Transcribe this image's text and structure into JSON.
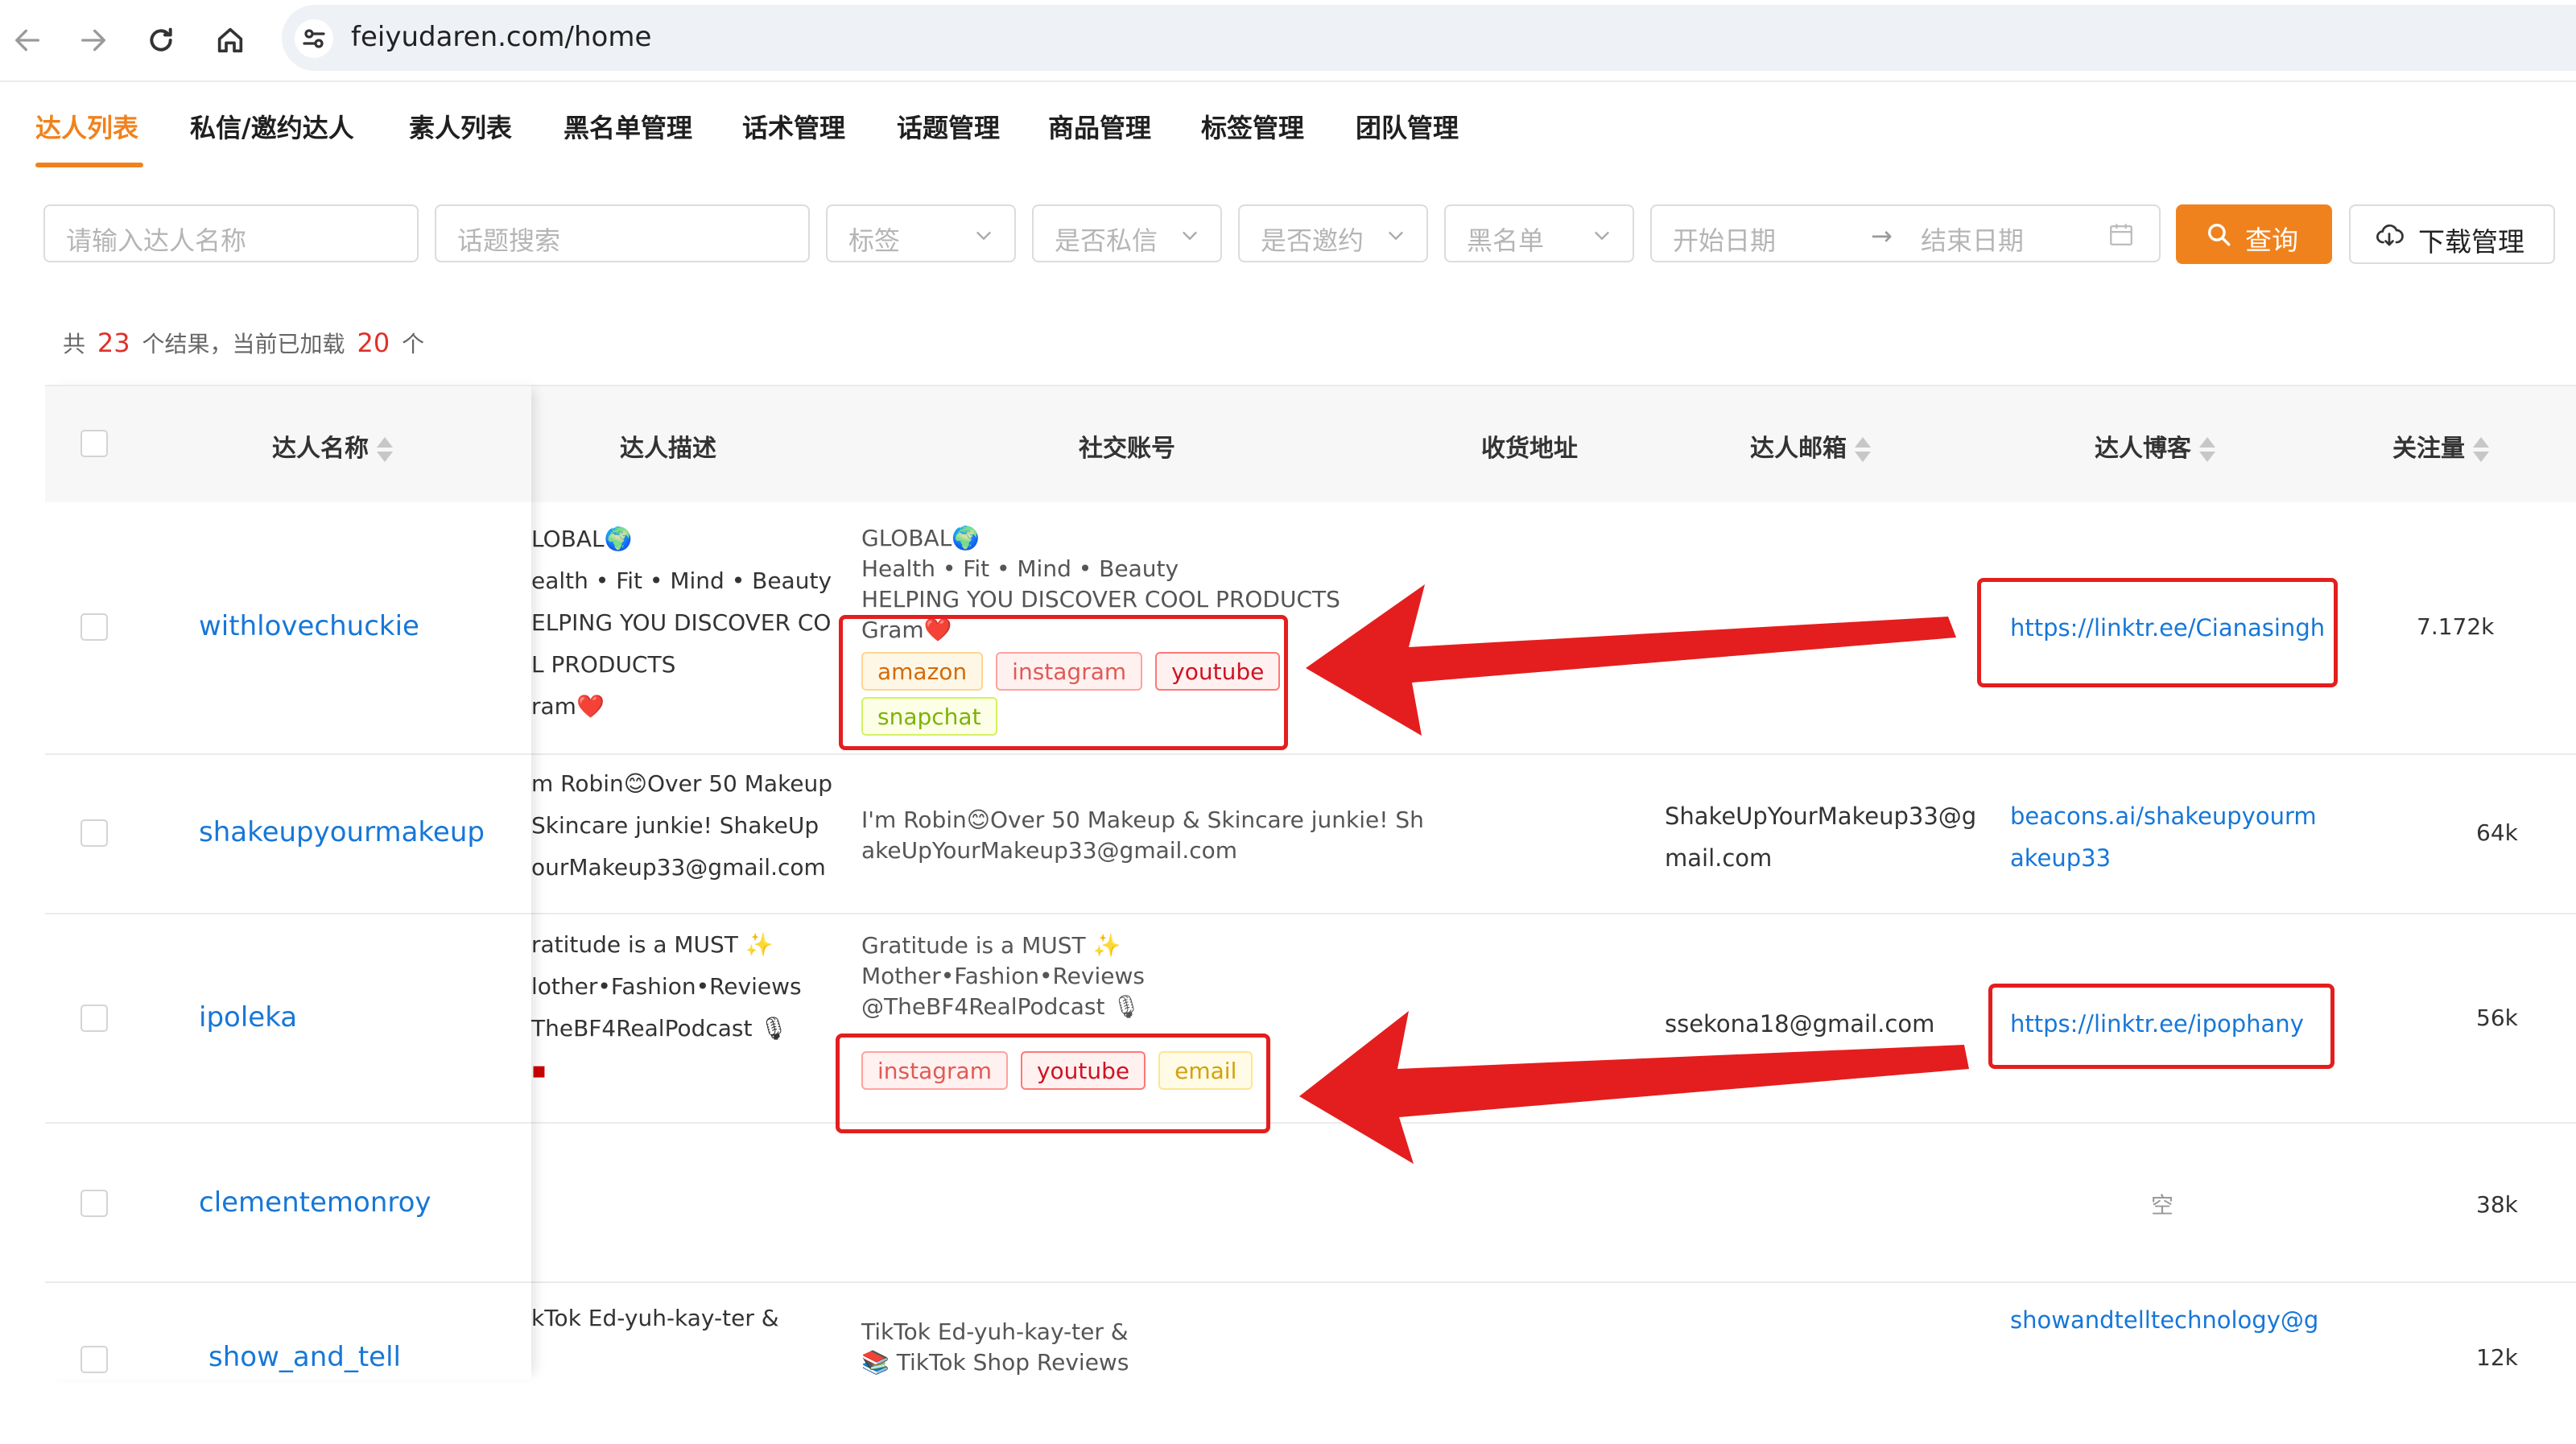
{
  "browser": {
    "url": "feiyudaren.com/home"
  },
  "menu": {
    "items": [
      {
        "label": "达人列表",
        "active": true
      },
      {
        "label": "私信/邀约达人"
      },
      {
        "label": "素人列表"
      },
      {
        "label": "黑名单管理"
      },
      {
        "label": "话术管理"
      },
      {
        "label": "话题管理"
      },
      {
        "label": "商品管理"
      },
      {
        "label": "标签管理"
      },
      {
        "label": "团队管理"
      }
    ]
  },
  "filters": {
    "name_placeholder": "请输入达人名称",
    "topic_placeholder": "话题搜索",
    "tag_select": "标签",
    "dm_select": "是否私信",
    "invite_select": "是否邀约",
    "blacklist_select": "黑名单",
    "start_date": "开始日期",
    "end_date": "结束日期",
    "date_separator": "→",
    "query_label": "查询",
    "download_label": "下载管理"
  },
  "summary": {
    "prefix": "共",
    "total": "23",
    "middle": "个结果，当前已加载",
    "loaded": "20",
    "suffix": "个"
  },
  "table": {
    "columns": {
      "name": "达人名称",
      "description": "达人描述",
      "social": "社交账号",
      "address": "收货地址",
      "email": "达人邮箱",
      "blog": "达人博客",
      "followers": "关注量"
    },
    "rows": [
      {
        "name": "withlovechuckie",
        "description": [
          "LOBAL🌍",
          "ealth • Fit • Mind • Beauty",
          "ELPING YOU DISCOVER CO",
          "L PRODUCTS",
          "ram❤️"
        ],
        "social_text": [
          "GLOBAL🌍",
          "Health • Fit • Mind • Beauty",
          "HELPING YOU DISCOVER COOL PRODUCTS",
          "Gram❤️"
        ],
        "tags": [
          "amazon",
          "instagram",
          "youtube",
          "snapchat"
        ],
        "email": [],
        "blog": [
          "https://linktr.ee/Cianasingh"
        ],
        "followers": "7.172k"
      },
      {
        "name": "shakeupyourmakeup",
        "description": [
          "m Robin😊Over 50 Makeup",
          " Skincare junkie! ShakeUp",
          "ourMakeup33@gmail.com"
        ],
        "social_text": [
          "I'm Robin😊Over 50 Makeup & Skincare junkie! Sh",
          "akeUpYourMakeup33@gmail.com"
        ],
        "tags": [],
        "email": [
          "ShakeUpYourMakeup33@g",
          "mail.com"
        ],
        "blog": [
          "beacons.ai/shakeupyourm",
          "akeup33"
        ],
        "followers": "64k"
      },
      {
        "name": "ipoleka",
        "description": [
          "ratitude is a MUST ✨",
          "lother•Fashion•Reviews",
          "TheBF4RealPodcast 🎙",
          "▪"
        ],
        "social_text": [
          "Gratitude is a MUST ✨",
          "Mother•Fashion•Reviews",
          "@TheBF4RealPodcast 🎙"
        ],
        "tags": [
          "instagram",
          "youtube",
          "email"
        ],
        "email": [
          "ssekona18@gmail.com"
        ],
        "blog": [
          "https://linktr.ee/ipophany"
        ],
        "followers": "56k"
      },
      {
        "name": "clementemonroy",
        "description": [],
        "social_text": [],
        "tags": [],
        "email": [],
        "blog": [],
        "blog_empty": "空",
        "followers": "38k"
      },
      {
        "name": "show_and_tell",
        "description": [
          "kTok Ed-yuh-kay-ter &"
        ],
        "social_text": [
          "TikTok Ed-yuh-kay-ter &",
          "📚 TikTok Shop Reviews"
        ],
        "tags": [],
        "email": [],
        "blog": [
          "showandtelltechnology@g"
        ],
        "followers": "12k"
      }
    ]
  },
  "colors": {
    "accent": "#f0821d",
    "link": "#1677d8",
    "annotation_red": "#e41e1e",
    "count_red": "#e0302a"
  },
  "icons": {
    "back": "arrow-left-icon",
    "forward": "arrow-right-icon",
    "reload": "reload-icon",
    "home": "home-icon",
    "site_settings": "site-settings-icon",
    "search": "search-icon",
    "download": "cloud-download-icon",
    "calendar": "calendar-icon"
  }
}
